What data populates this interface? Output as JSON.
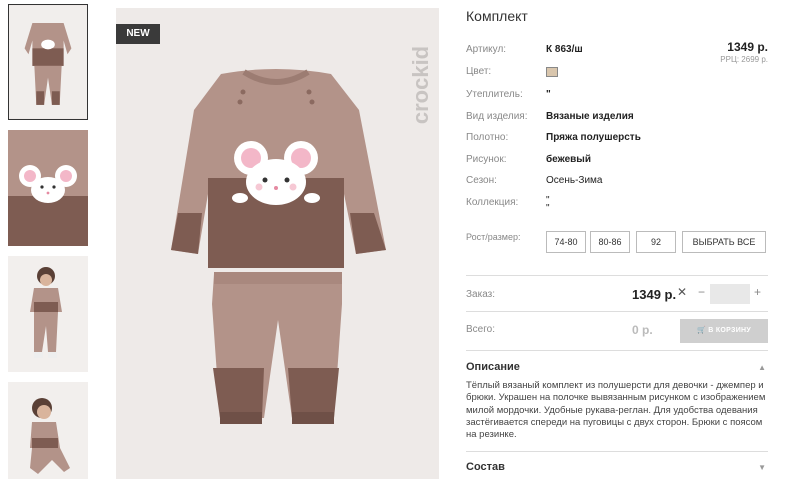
{
  "gallery": {
    "thumbnails": [
      {
        "alt": "set-front"
      },
      {
        "alt": "mouse-detail"
      },
      {
        "alt": "model-standing"
      },
      {
        "alt": "model-sitting"
      }
    ],
    "badge": "NEW",
    "brand": "crockid"
  },
  "product": {
    "title": "Комплект",
    "price": "1349 р.",
    "rrp": "РРЦ: 2699 р.",
    "attributes": [
      {
        "label": "Артикул:",
        "value": "К 863/ш",
        "bold": true
      },
      {
        "label": "Цвет:",
        "value": "",
        "swatch": "#d9c6ad"
      },
      {
        "label": "Утеплитель:",
        "value": "\"",
        "bold": true
      },
      {
        "label": "Вид изделия:",
        "value": "Вязаные изделия",
        "bold": true
      },
      {
        "label": "Полотно:",
        "value": "Пряжа полушерсть",
        "bold": true
      },
      {
        "label": "Рисунок:",
        "value": "бежевый",
        "bold": true
      },
      {
        "label": "Сезон:",
        "value": "Осень-Зима",
        "bold": false
      },
      {
        "label": "Коллекция:",
        "value": "\"\n\"",
        "bold": false
      }
    ],
    "sizes_label": "Рост/размер:",
    "sizes": [
      "74-80",
      "80-86",
      "92"
    ],
    "select_all": "ВЫБРАТЬ ВСЕ"
  },
  "order": {
    "label": "Заказ:",
    "price": "1349 р.",
    "multiply": "✕",
    "minus": "−",
    "plus": "+",
    "quantity": ""
  },
  "total": {
    "label": "Всего:",
    "value": "0 р.",
    "cart_button": "В КОРЗИНУ"
  },
  "description": {
    "title": "Описание",
    "text": "Тёплый вязаный комплект из полушерсти для девочки - джемпер и брюки. Украшен на полочке вывязанным рисунком с изображением милой мордочки. Удобные рукава-реглан. Для удобства одевания застёгивается спереди на пуговицы с двух сторон. Брюки с поясом на резинке.",
    "chevron": "▲"
  },
  "composition": {
    "title": "Состав",
    "chevron": "▼"
  },
  "colors": {
    "light_brown": "#b39389",
    "dark_brown": "#7e5c52",
    "background": "#eeeae8"
  }
}
